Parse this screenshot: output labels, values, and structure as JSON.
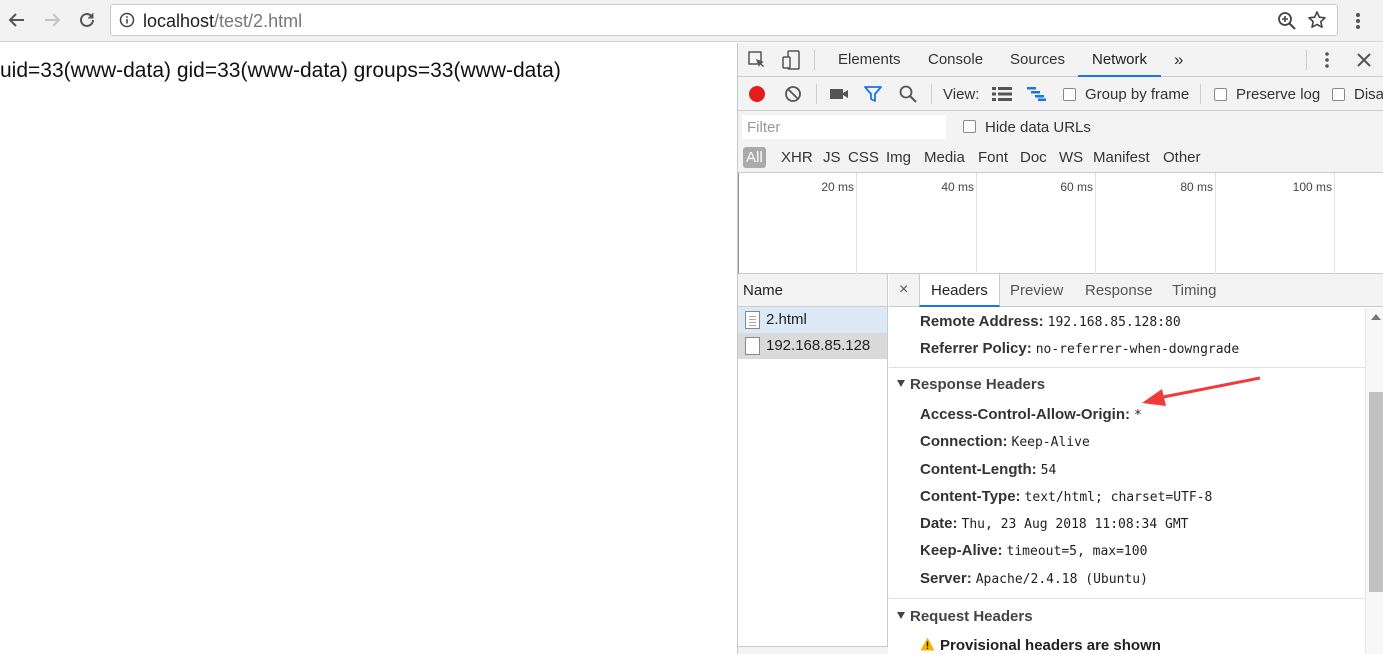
{
  "browser": {
    "url_host": "localhost",
    "url_path": "/test/2.html"
  },
  "page": {
    "text": "uid=33(www-data) gid=33(www-data) groups=33(www-data)"
  },
  "devtools": {
    "tabs": [
      {
        "label": "Elements"
      },
      {
        "label": "Console"
      },
      {
        "label": "Sources"
      },
      {
        "label": "Network"
      }
    ],
    "more_tabs": "»",
    "toolbar": {
      "view_label": "View:",
      "group_by_frame": "Group by frame",
      "preserve_log": "Preserve log",
      "disable_cache": "Disa"
    },
    "filter": {
      "placeholder": "Filter",
      "hide_data_urls": "Hide data URLs",
      "types": [
        "All",
        "XHR",
        "JS",
        "CSS",
        "Img",
        "Media",
        "Font",
        "Doc",
        "WS",
        "Manifest",
        "Other"
      ]
    },
    "overview": {
      "ticks": [
        "20 ms",
        "40 ms",
        "60 ms",
        "80 ms",
        "100 ms"
      ]
    },
    "requests": {
      "header": "Name",
      "items": [
        "2.html",
        "192.168.85.128"
      ]
    },
    "details": {
      "close": "×",
      "tabs": [
        "Headers",
        "Preview",
        "Response",
        "Timing"
      ],
      "general": [
        {
          "key": "Remote Address:",
          "value": "192.168.85.128:80"
        },
        {
          "key": "Referrer Policy:",
          "value": "no-referrer-when-downgrade"
        }
      ],
      "response_headers_title": "Response Headers",
      "response_headers": [
        {
          "key": "Access-Control-Allow-Origin:",
          "value": "*"
        },
        {
          "key": "Connection:",
          "value": "Keep-Alive"
        },
        {
          "key": "Content-Length:",
          "value": "54"
        },
        {
          "key": "Content-Type:",
          "value": "text/html; charset=UTF-8"
        },
        {
          "key": "Date:",
          "value": "Thu, 23 Aug 2018 11:08:34 GMT"
        },
        {
          "key": "Keep-Alive:",
          "value": "timeout=5, max=100"
        },
        {
          "key": "Server:",
          "value": "Apache/2.4.18 (Ubuntu)"
        }
      ],
      "request_headers_title": "Request Headers",
      "provisional_warning": "Provisional headers are shown"
    }
  },
  "colors": {
    "accent": "#1a73e8",
    "record": "#e41e1e",
    "filter_active": "#1a73e8",
    "annotation_arrow": "#f23a3a"
  }
}
